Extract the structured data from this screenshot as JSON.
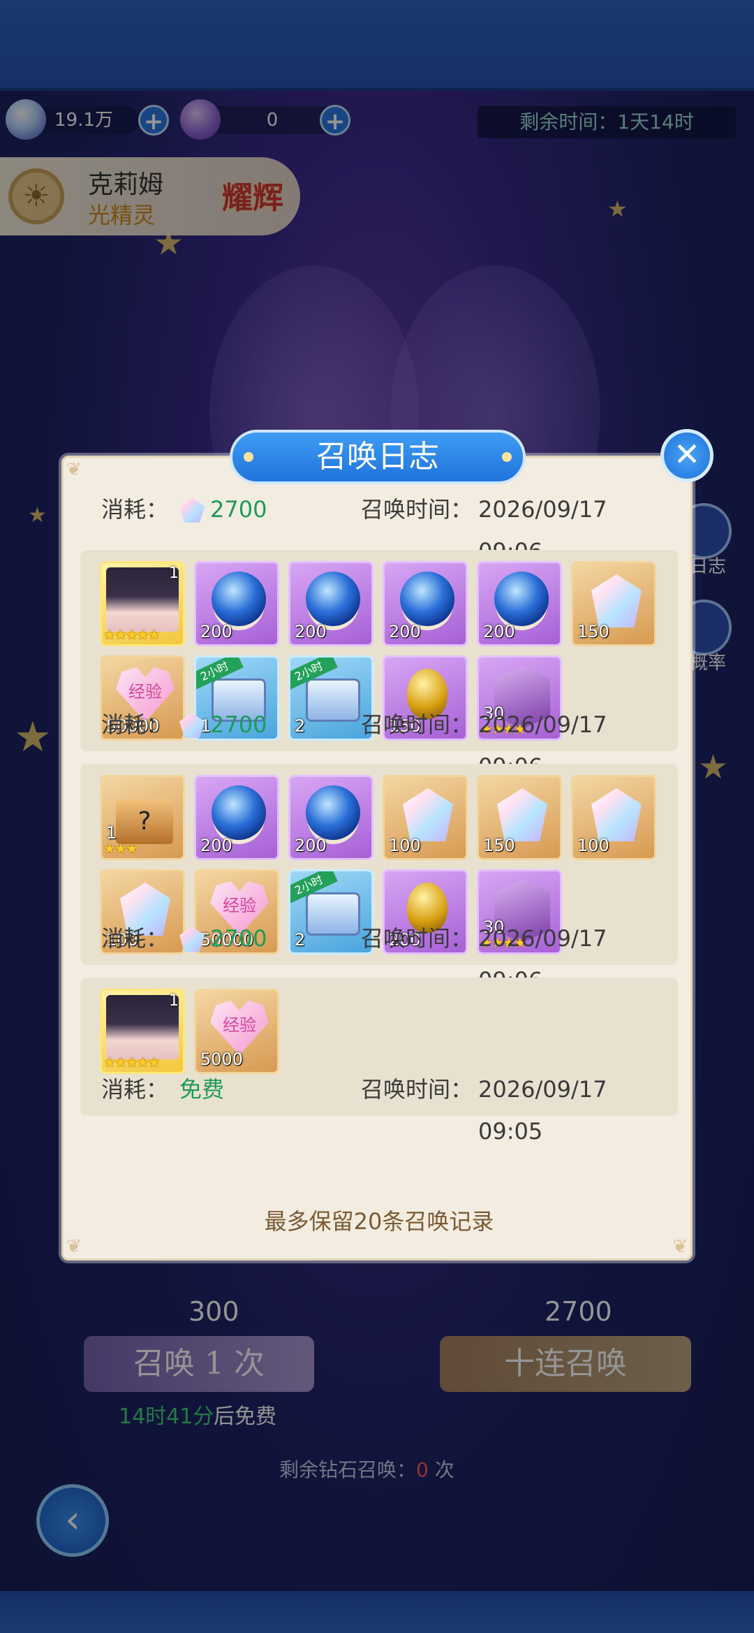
{
  "resources": {
    "diamonds": "19.1万",
    "notes": "0",
    "remaining_time": "剩余时间：1天14时"
  },
  "character": {
    "name": "克莉姆",
    "element": "光精灵",
    "rank": "耀辉"
  },
  "side_buttons": [
    "日志",
    "概率"
  ],
  "bottom": {
    "single_cost": "300",
    "ten_cost": "2700",
    "single_label": "召唤 1 次",
    "ten_label": "十连召唤",
    "free_timer": "14时41分",
    "free_suffix": "后免费",
    "remaining_label": "剩余钻石召唤：",
    "remaining_count": "0",
    "remaining_unit": "次"
  },
  "dialog": {
    "title": "召唤日志",
    "close_icon": "close-icon",
    "footer": "最多保留20条召唤记录",
    "cost_label": "消耗：",
    "time_label": "召唤时间：",
    "records": [
      {
        "cost": "2700",
        "time": "2026/09/17 09:06",
        "items": []
      },
      {
        "cost": "2700",
        "time": "2026/09/17 09:06",
        "items": [
          {
            "type": "char",
            "qty": "1",
            "stars": "★★★★★"
          },
          {
            "type": "orb",
            "qty": "200"
          },
          {
            "type": "orb",
            "qty": "200"
          },
          {
            "type": "orb",
            "qty": "200"
          },
          {
            "type": "orb",
            "qty": "200"
          },
          {
            "type": "crystal",
            "qty": "150"
          },
          {
            "type": "exp",
            "qty": "50000",
            "label": "经验"
          },
          {
            "type": "chest",
            "qty": "1",
            "badge": "2小时"
          },
          {
            "type": "chest",
            "qty": "2",
            "badge": "2小时"
          },
          {
            "type": "egg",
            "qty": "150"
          },
          {
            "type": "cube",
            "qty": "30",
            "stars": "★★★★"
          }
        ]
      },
      {
        "cost": "2700",
        "time": "2026/09/17 09:06",
        "items": [
          {
            "type": "box",
            "qty": "1",
            "stars": "★★★"
          },
          {
            "type": "orb",
            "qty": "200"
          },
          {
            "type": "orb",
            "qty": "200"
          },
          {
            "type": "crystal",
            "qty": "100"
          },
          {
            "type": "crystal",
            "qty": "150"
          },
          {
            "type": "crystal",
            "qty": "100"
          },
          {
            "type": "crystal",
            "qty": "100"
          },
          {
            "type": "exp",
            "qty": "50000",
            "label": "经验"
          },
          {
            "type": "chest",
            "qty": "2",
            "badge": "2小时"
          },
          {
            "type": "egg",
            "qty": "200"
          },
          {
            "type": "cube",
            "qty": "30",
            "stars": "★★★★"
          }
        ]
      },
      {
        "cost": "免费",
        "time": "2026/09/17 09:05",
        "items": [
          {
            "type": "char",
            "qty": "1",
            "stars": "★★★★★"
          },
          {
            "type": "exp",
            "qty": "5000",
            "label": "经验"
          }
        ]
      }
    ]
  }
}
